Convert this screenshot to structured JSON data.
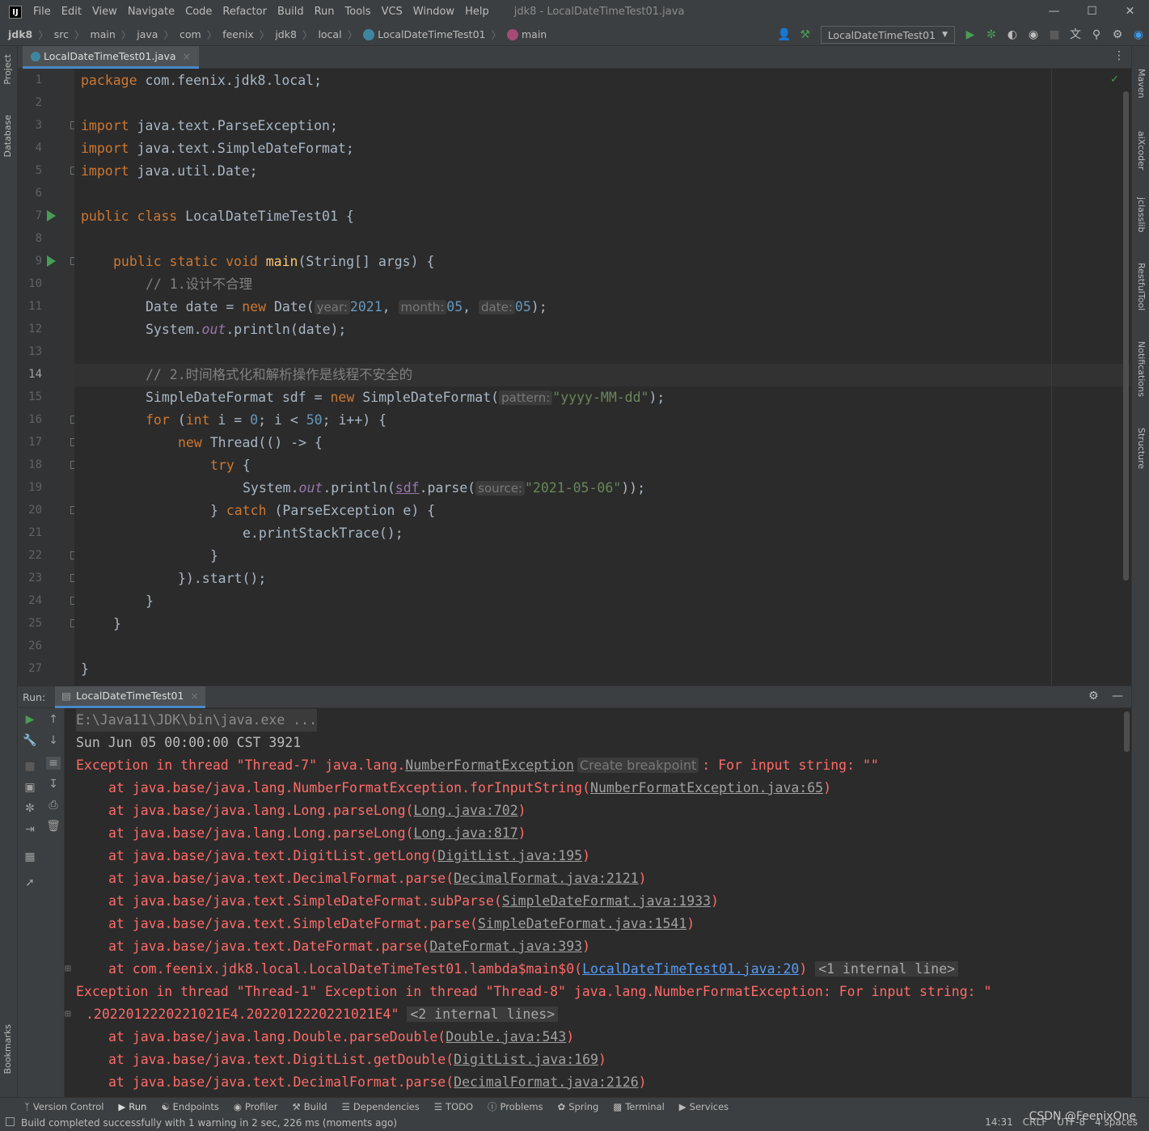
{
  "menubar": {
    "logo": "IJ",
    "items": [
      "File",
      "Edit",
      "View",
      "Navigate",
      "Code",
      "Refactor",
      "Build",
      "Run",
      "Tools",
      "VCS",
      "Window",
      "Help"
    ],
    "title": "jdk8 - LocalDateTimeTest01.java"
  },
  "breadcrumbs": [
    "jdk8",
    "src",
    "main",
    "java",
    "com",
    "feenix",
    "jdk8",
    "local",
    "LocalDateTimeTest01",
    "main"
  ],
  "toolbar": {
    "run_config": "LocalDateTimeTest01"
  },
  "left_tabs": [
    "Project",
    "Database",
    "Bookmarks"
  ],
  "right_tabs": [
    "Maven",
    "aiXcoder",
    "jclasslib",
    "RestfulTool",
    "Notifications",
    "Structure"
  ],
  "editor_tab": {
    "label": "LocalDateTimeTest01.java"
  },
  "code": {
    "line_numbers": [
      "1",
      "2",
      "3",
      "4",
      "5",
      "6",
      "7",
      "8",
      "9",
      "10",
      "11",
      "12",
      "13",
      "14",
      "15",
      "16",
      "17",
      "18",
      "19",
      "20",
      "21",
      "22",
      "23",
      "24",
      "25",
      "26",
      "27"
    ],
    "current_line": "14",
    "l1_kw": "package",
    "l1_rest": " com.feenix.jdk8.local;",
    "l3_kw": "import",
    "l3_rest": " java.text.ParseException;",
    "l4_kw": "import",
    "l4_rest": " java.text.SimpleDateFormat;",
    "l5_kw": "import",
    "l5_rest": " java.util.Date;",
    "l7_kw": "public class",
    "l7_rest": " LocalDateTimeTest01 {",
    "l9_kw": "public static void",
    "l9_fn": "main",
    "l9_rest": "(String[] args) {",
    "l10_cm": "// 1.设计不合理",
    "l11_a": "Date date = ",
    "l11_kw": "new",
    "l11_b": " Date(",
    "l11_h1": "year:",
    "l11_v1": "2021",
    "l11_h2": "month:",
    "l11_v2": "05",
    "l11_h3": "date:",
    "l11_v3": "05",
    "l11_end": ");",
    "l12_a": "System.",
    "l12_it": "out",
    "l12_b": ".println(date);",
    "l14_cm": "// 2.时间格式化和解析操作是线程不安全的",
    "l15_a": "SimpleDateFormat sdf = ",
    "l15_kw": "new",
    "l15_b": " SimpleDateFormat(",
    "l15_h": "pattern:",
    "l15_s": "\"yyyy-MM-dd\"",
    "l15_end": ");",
    "l16_kw": "for",
    "l16_a": " (",
    "l16_kw2": "int",
    "l16_b": " i = ",
    "l16_n1": "0",
    "l16_c": "; i < ",
    "l16_n2": "50",
    "l16_d": "; i++) {",
    "l17_kw": "new",
    "l17_rest": " Thread(() -> {",
    "l18_kw": "try",
    "l18_rest": " {",
    "l19_a": "System.",
    "l19_it": "out",
    "l19_b": ".println(",
    "l19_f": "sdf",
    "l19_c": ".parse(",
    "l19_h": "source:",
    "l19_s": "\"2021-05-06\"",
    "l19_end": "));",
    "l20_a": "} ",
    "l20_kw": "catch",
    "l20_rest": " (ParseException e) {",
    "l21": "e.printStackTrace();",
    "l22": "}",
    "l23": "}).start();",
    "l24": "}",
    "l25": "}",
    "l27": "}"
  },
  "run_panel": {
    "label": "Run:",
    "tab": "LocalDateTimeTest01"
  },
  "console": {
    "c1": "E:\\Java11\\JDK\\bin\\java.exe ...",
    "c2": "Sun Jun 05 00:00:00 CST 3921",
    "c3_a": "Exception in thread \"Thread-7\" java.lang.",
    "c3_link": "NumberFormatException",
    "c3_hint": "Create breakpoint",
    "c3_b": ": For input string: \"\"",
    "c4_a": "at java.base/java.lang.NumberFormatException.forInputString(",
    "c4_l": "NumberFormatException.java:65",
    "c4_b": ")",
    "c5_a": "at java.base/java.lang.Long.parseLong(",
    "c5_l": "Long.java:702",
    "c5_b": ")",
    "c6_a": "at java.base/java.lang.Long.parseLong(",
    "c6_l": "Long.java:817",
    "c6_b": ")",
    "c7_a": "at java.base/java.text.DigitList.getLong(",
    "c7_l": "DigitList.java:195",
    "c7_b": ")",
    "c8_a": "at java.base/java.text.DecimalFormat.parse(",
    "c8_l": "DecimalFormat.java:2121",
    "c8_b": ")",
    "c9_a": "at java.base/java.text.SimpleDateFormat.subParse(",
    "c9_l": "SimpleDateFormat.java:1933",
    "c9_b": ")",
    "c10_a": "at java.base/java.text.SimpleDateFormat.parse(",
    "c10_l": "SimpleDateFormat.java:1541",
    "c10_b": ")",
    "c11_a": "at java.base/java.text.DateFormat.parse(",
    "c11_l": "DateFormat.java:393",
    "c11_b": ")",
    "c12_a": "at com.feenix.jdk8.local.LocalDateTimeTest01.lambda$main$0(",
    "c12_l": "LocalDateTimeTest01.java:20",
    "c12_b": ")",
    "c12_fold": "<1 internal line>",
    "c13": "Exception in thread \"Thread-1\" Exception in thread \"Thread-8\" java.lang.NumberFormatException: For input string: \"",
    "c14_a": ".2022012220221021E4.2022012220221021E4\"",
    "c14_fold": "<2 internal lines>",
    "c15_a": "at java.base/java.lang.Double.parseDouble(",
    "c15_l": "Double.java:543",
    "c15_b": ")",
    "c16_a": "at java.base/java.text.DigitList.getDouble(",
    "c16_l": "DigitList.java:169",
    "c16_b": ")",
    "c17_a": "at java.base/java.text.DecimalFormat.parse(",
    "c17_l": "DecimalFormat.java:2126",
    "c17_b": ")"
  },
  "bottom_tabs": [
    "Version Control",
    "Run",
    "Endpoints",
    "Profiler",
    "Build",
    "Dependencies",
    "TODO",
    "Problems",
    "Spring",
    "Terminal",
    "Services"
  ],
  "status": {
    "message": "Build completed successfully with 1 warning in 2 sec, 226 ms (moments ago)",
    "position": "14:31",
    "line_sep": "CRLF",
    "encoding": "UTF-8",
    "indent": "4 spaces",
    "watermark": "CSDN @FeenixOne"
  }
}
